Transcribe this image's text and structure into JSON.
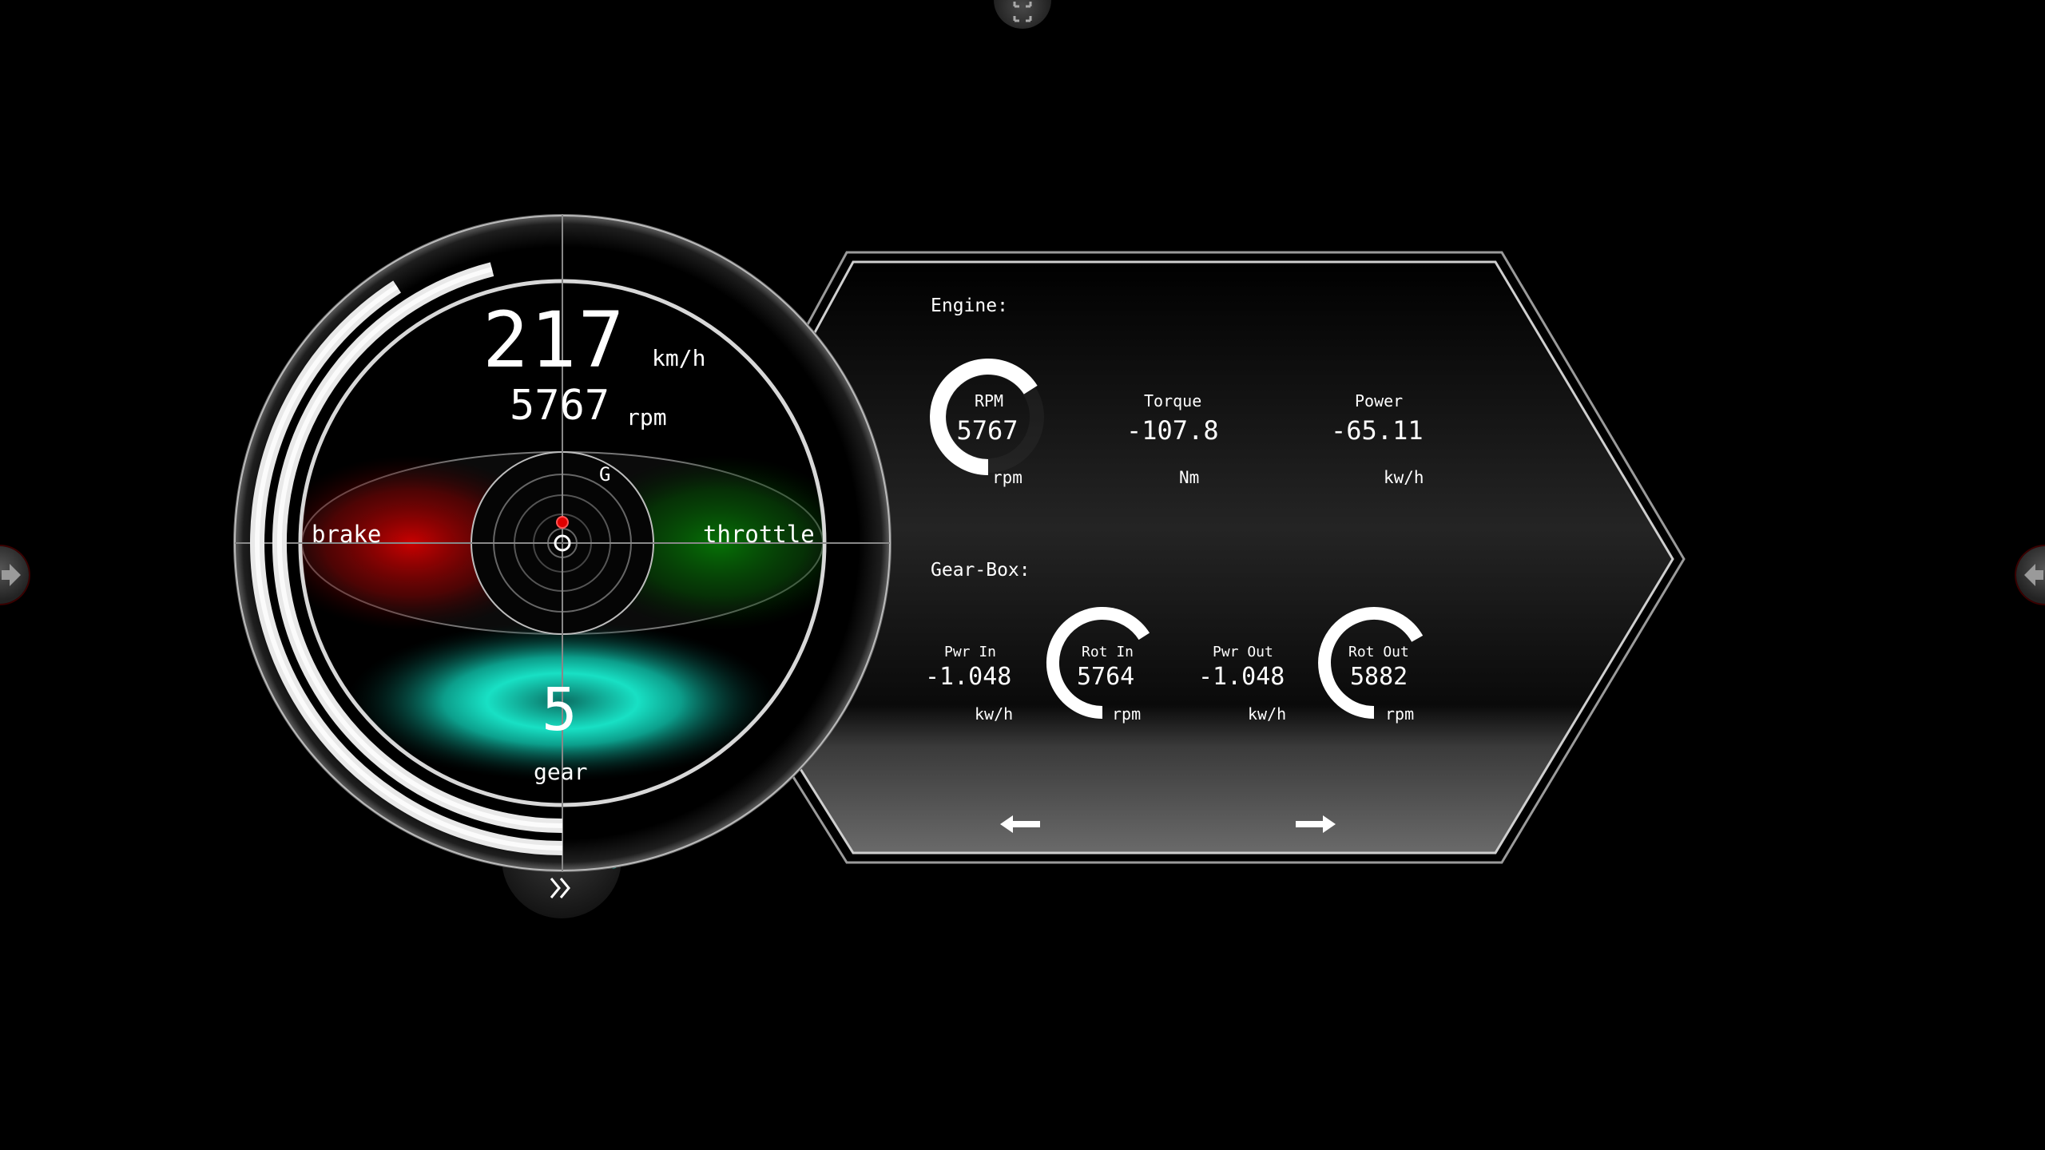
{
  "speedometer": {
    "speed_value": "217",
    "speed_unit": "km/h",
    "rpm_value": "5767",
    "rpm_unit": "rpm",
    "g_label": "G",
    "brake_label": "brake",
    "throttle_label": "throttle",
    "gear_value": "5",
    "gear_label": "gear",
    "speed_fraction": 0.64,
    "rpm_fraction": 0.72
  },
  "engine": {
    "section_title": "Engine:",
    "rpm": {
      "label": "RPM",
      "value": "5767",
      "unit": "rpm",
      "fraction": 0.72,
      "color": "#ffffff"
    },
    "torque": {
      "label": "Torque",
      "value": "-107.8",
      "unit": "Nm",
      "fraction": 0.12,
      "color": "#ff2a2a"
    },
    "power": {
      "label": "Power",
      "value": "-65.11",
      "unit": "kw/h",
      "fraction": 0.12,
      "color": "#ff2a2a"
    }
  },
  "gearbox": {
    "section_title": "Gear-Box:",
    "pwr_in": {
      "label": "Pwr In",
      "value": "-1.048",
      "unit": "kw/h",
      "fraction": 0.03,
      "color": "#ff2a2a"
    },
    "rot_in": {
      "label": "Rot In",
      "value": "5764",
      "unit": "rpm",
      "fraction": 0.72,
      "color": "#ffffff"
    },
    "pwr_out": {
      "label": "Pwr Out",
      "value": "-1.048",
      "unit": "kw/h",
      "fraction": 0.03,
      "color": "#ff2a2a"
    },
    "rot_out": {
      "label": "Rot Out",
      "value": "5882",
      "unit": "rpm",
      "fraction": 0.73,
      "color": "#ffffff"
    }
  },
  "nav": {
    "prev_icon": "arrow-left-icon",
    "next_icon": "arrow-right-icon",
    "expand_icon": "double-chevron-right-icon",
    "fullscreen_icon": "fullscreen-icon",
    "left_tab_icon": "arrow-right-icon",
    "right_tab_icon": "arrow-left-icon"
  }
}
